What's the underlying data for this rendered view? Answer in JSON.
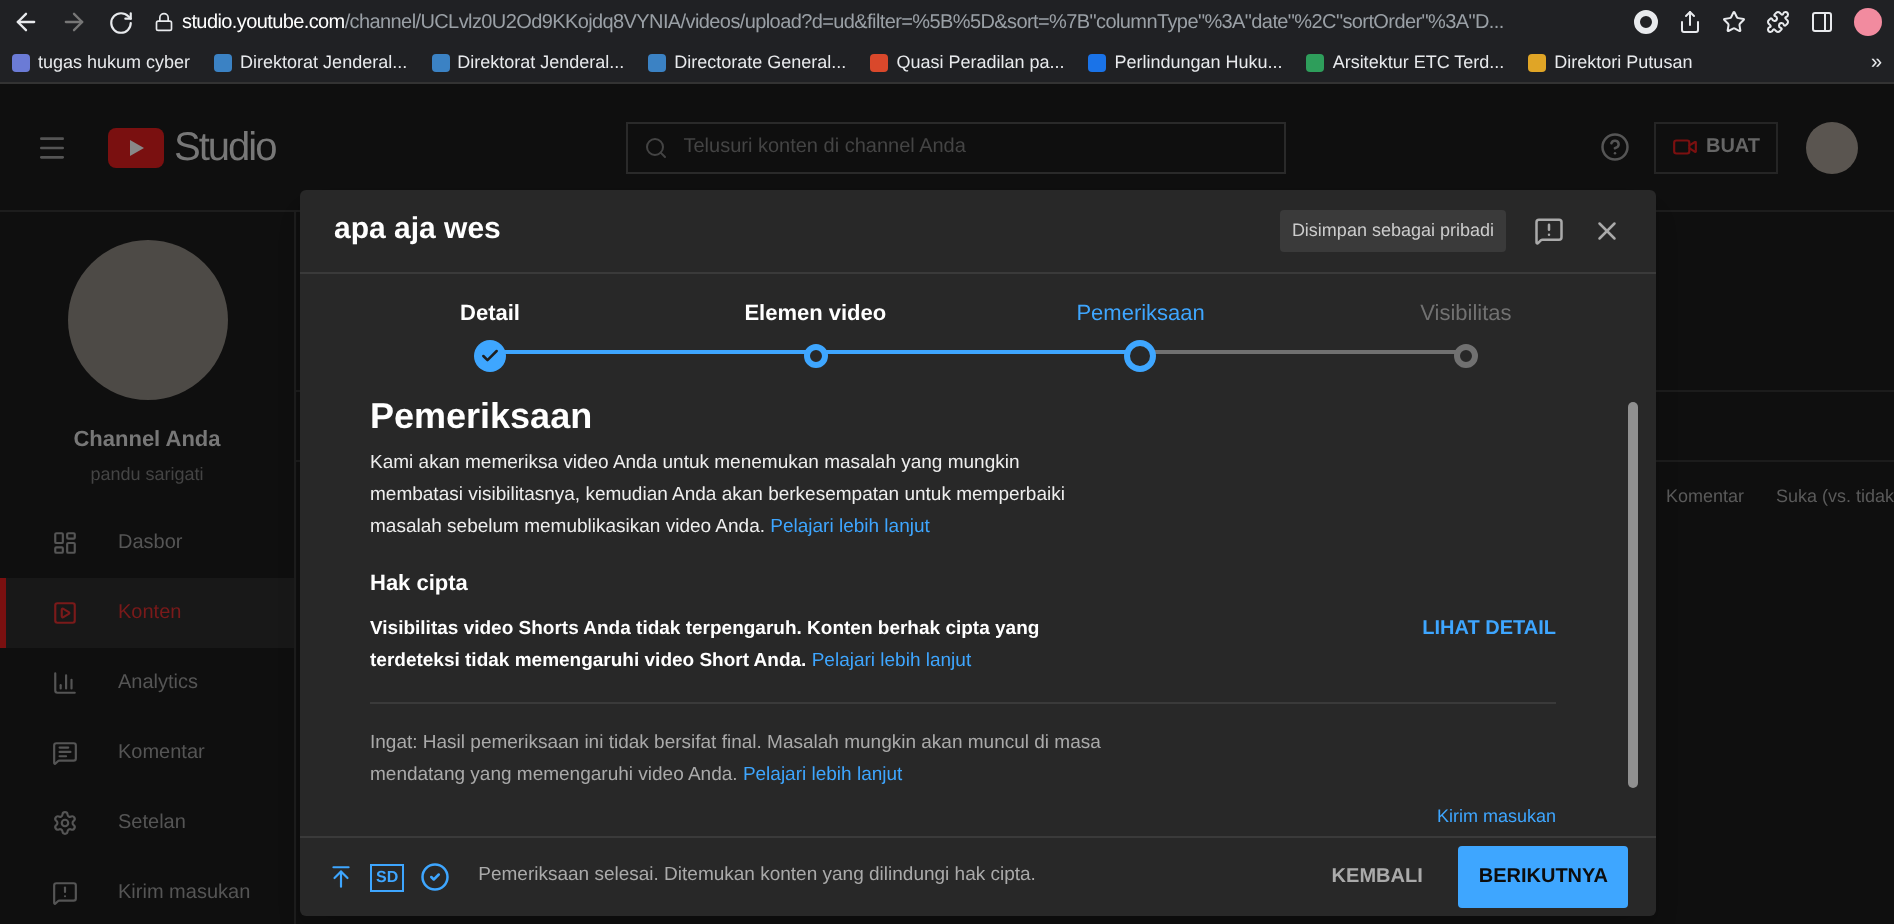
{
  "browser": {
    "url_host": "studio.youtube.com",
    "url_path": "/channel/UCLvlz0U2Od9KKojdq8VYNIA/videos/upload?d=ud&filter=%5B%5D&sort=%7B\"columnType\"%3A\"date\"%2C\"sortOrder\"%3A\"D...",
    "bookmarks": [
      {
        "label": "tugas hukum cyber",
        "color": "#6b7bd6"
      },
      {
        "label": "Direktorat Jenderal...",
        "color": "#3b82c4"
      },
      {
        "label": "Direktorat Jenderal...",
        "color": "#3b82c4"
      },
      {
        "label": "Directorate General...",
        "color": "#3b82c4"
      },
      {
        "label": "Quasi Peradilan pa...",
        "color": "#d9482b"
      },
      {
        "label": "Perlindungan Huku...",
        "color": "#1a73e8"
      },
      {
        "label": "Arsitektur ETC Terd...",
        "color": "#2e9e5b"
      },
      {
        "label": "Direktori Putusan",
        "color": "#e0a526"
      }
    ],
    "more": "»"
  },
  "studio": {
    "logo": "Studio",
    "search_placeholder": "Telusuri konten di channel Anda",
    "create_label": "BUAT",
    "channel": {
      "title": "Channel Anda",
      "name": "pandu sarigati"
    },
    "nav": [
      {
        "label": "Dasbor",
        "selected": false
      },
      {
        "label": "Konten",
        "selected": true
      },
      {
        "label": "Analytics",
        "selected": false
      },
      {
        "label": "Komentar",
        "selected": false
      },
      {
        "label": "Setelan",
        "selected": false
      },
      {
        "label": "Kirim masukan",
        "selected": false
      }
    ],
    "columns": [
      "Komentar",
      "Suka (vs. tidak"
    ]
  },
  "dialog": {
    "title": "apa aja wes",
    "save_status": "Disimpan sebagai pribadi",
    "steps": [
      {
        "label": "Detail",
        "kind": "done"
      },
      {
        "label": "Elemen video",
        "kind": "visited"
      },
      {
        "label": "Pemeriksaan",
        "kind": "current"
      },
      {
        "label": "Visibilitas",
        "kind": "upcoming"
      }
    ],
    "heading": "Pemeriksaan",
    "intro": "Kami akan memeriksa video Anda untuk menemukan masalah yang mungkin membatasi visibilitasnya, kemudian Anda akan berkesempatan untuk memperbaiki masalah sebelum memublikasikan video Anda.",
    "intro_link": "Pelajari lebih lanjut",
    "copyright": {
      "title": "Hak cipta",
      "text": "Visibilitas video Shorts Anda tidak terpengaruh. Konten berhak cipta yang terdeteksi tidak memengaruhi video Short Anda.",
      "link": "Pelajari lebih lanjut",
      "action": "LIHAT DETAIL"
    },
    "note": "Ingat: Hasil pemeriksaan ini tidak bersifat final. Masalah mungkin akan muncul di masa mendatang yang memengaruhi video Anda.",
    "note_link": "Pelajari lebih lanjut",
    "feedback": "Kirim masukan",
    "footer": {
      "quality": "SD",
      "status": "Pemeriksaan selesai. Ditemukan konten yang dilindungi hak cipta.",
      "back": "KEMBALI",
      "next": "BERIKUTNYA"
    }
  }
}
